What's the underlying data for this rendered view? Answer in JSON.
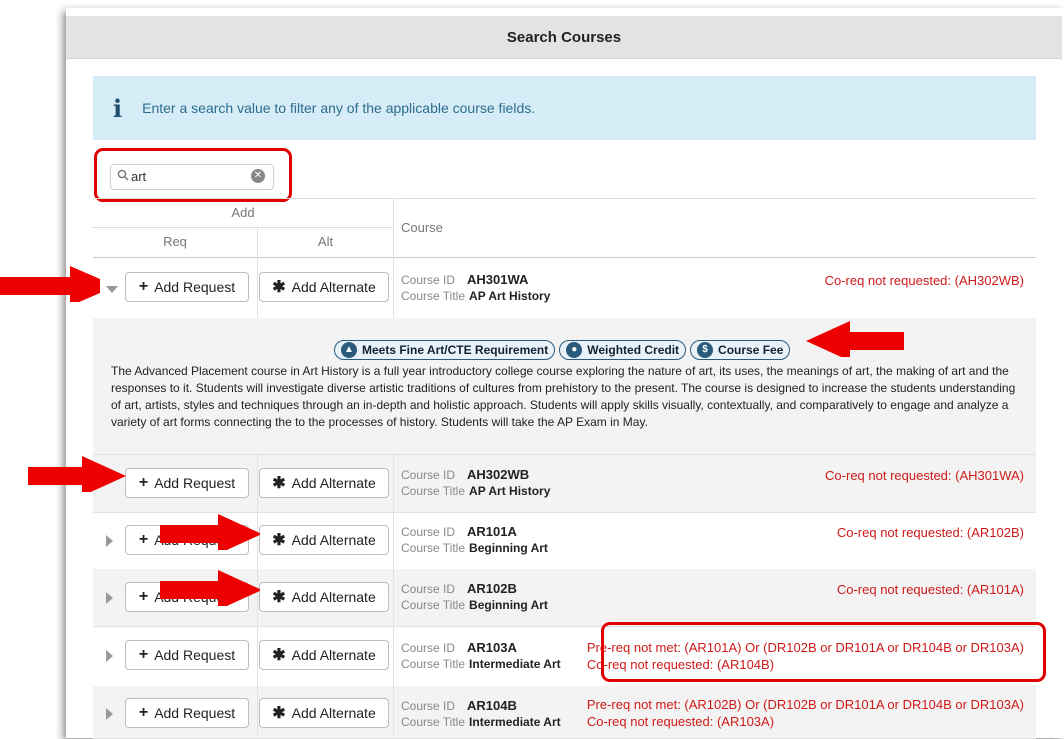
{
  "header": {
    "title": "Search Courses"
  },
  "info": {
    "icon": "info-icon",
    "text": "Enter a search value to filter any of the applicable course fields."
  },
  "search": {
    "value": "art",
    "icon": "search-icon"
  },
  "columns": {
    "add": "Add",
    "req": "Req",
    "alt": "Alt",
    "course": "Course"
  },
  "labels": {
    "course_id": "Course ID",
    "course_title": "Course Title",
    "add_request": "Add Request",
    "add_alternate": "Add Alternate"
  },
  "courses": [
    {
      "id": "AH301WA",
      "title": "AP Art History",
      "warning": [
        "Co-req not requested: (AH302WB)"
      ],
      "expanded": true
    },
    {
      "id": "AH302WB",
      "title": "AP Art History",
      "warning": [
        "Co-req not requested: (AH301WA)"
      ],
      "expanded": false
    },
    {
      "id": "AR101A",
      "title": "Beginning Art",
      "warning": [
        "Co-req not requested: (AR102B)"
      ],
      "expanded": false
    },
    {
      "id": "AR102B",
      "title": "Beginning Art",
      "warning": [
        "Co-req not requested: (AR101A)"
      ],
      "expanded": false
    },
    {
      "id": "AR103A",
      "title": "Intermediate Art",
      "warning": [
        "Pre-req not met: (AR101A) Or (DR102B or DR101A or DR104B or DR103A)",
        "Co-req not requested: (AR104B)"
      ],
      "expanded": false
    },
    {
      "id": "AR104B",
      "title": "Intermediate Art",
      "warning": [
        "Pre-req not met: (AR102B) Or (DR102B or DR101A or DR104B or DR103A)",
        "Co-req not requested: (AR103A)"
      ],
      "expanded": false
    }
  ],
  "detail": {
    "badges": [
      {
        "icon": "graduation-cap-icon",
        "label": "Meets Fine Art/CTE Requirement"
      },
      {
        "icon": "award-icon",
        "label": "Weighted Credit"
      },
      {
        "icon": "dollar-icon",
        "label": "Course Fee"
      }
    ],
    "description": "The Advanced Placement course in Art History is a full year introductory college course exploring the nature of art, its uses, the meanings of art, the making of art and the responses to it. Students will investigate diverse artistic traditions of cultures from prehistory to the present. The course is designed to increase the students understanding of art, artists, styles and techniques through an in-depth and holistic approach. Students will apply skills visually, contextually, and comparatively to engage and analyze a variety of art forms connecting the to the processes of history. Students will take the AP Exam in May."
  },
  "colors": {
    "warning": "#d01a1a",
    "annotation": "#e00000",
    "info_bg": "#d6ecf6"
  }
}
